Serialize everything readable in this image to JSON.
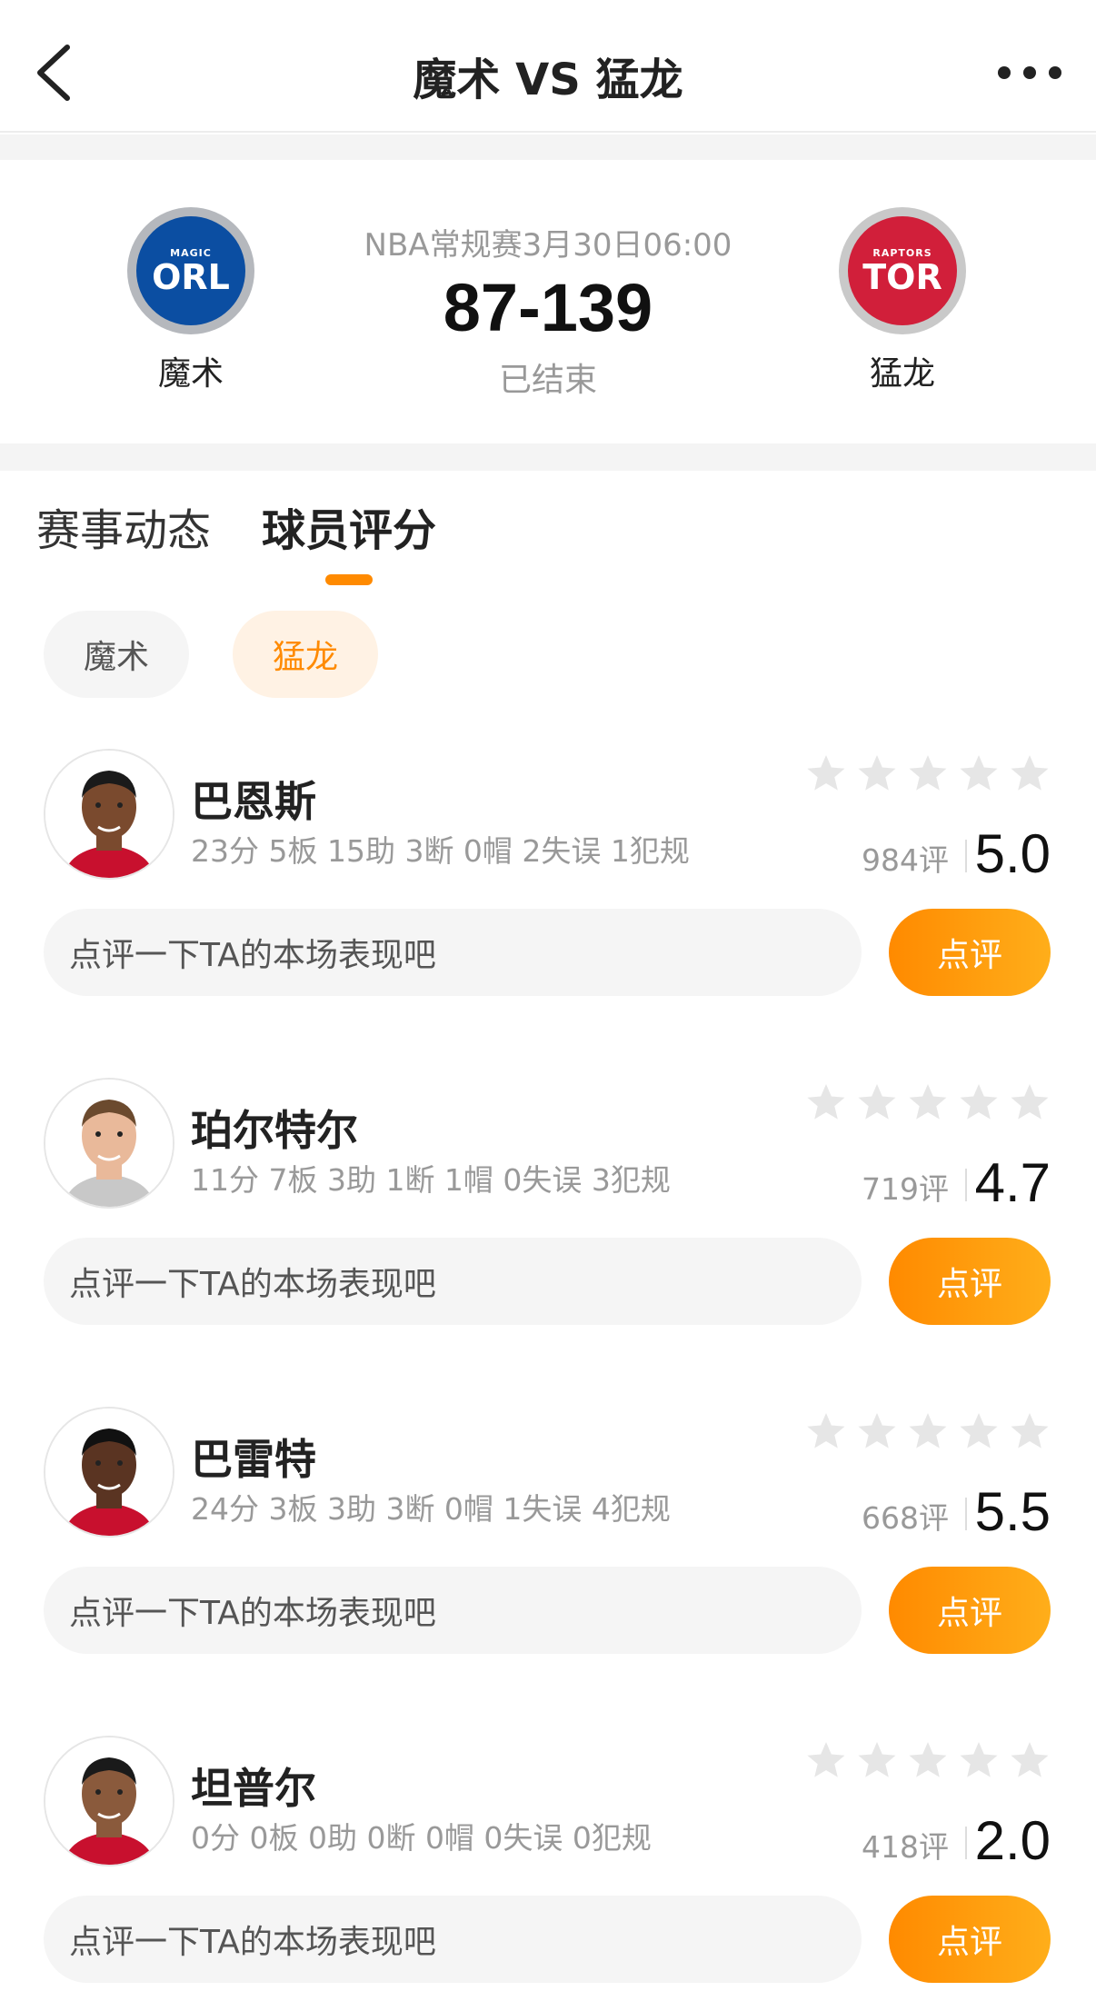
{
  "nav": {
    "title": "魔术 VS 猛龙",
    "back_icon": "chevron-left-icon",
    "more_icon": "more-dots-icon"
  },
  "match": {
    "home": {
      "name": "魔术",
      "logo_small": "MAGIC",
      "logo_big": "ORL",
      "color": "#0b4ea2"
    },
    "away": {
      "name": "猛龙",
      "logo_small": "RAPTORS",
      "logo_big": "TOR",
      "color": "#d11f3a"
    },
    "meta": "NBA常规赛3月30日06:00",
    "score": "87-139",
    "status": "已结束"
  },
  "tabs": [
    {
      "label": "赛事动态",
      "active": false
    },
    {
      "label": "球员评分",
      "active": true
    }
  ],
  "filters": [
    {
      "label": "魔术",
      "active": false
    },
    {
      "label": "猛龙",
      "active": true
    }
  ],
  "colors": {
    "accent": "#ff8a00",
    "star_empty": "#e6e6e6"
  },
  "players": [
    {
      "name": "巴恩斯",
      "stats": "23分 5板 15助 3断 0帽 2失误 1犯规",
      "count": "984评",
      "score": "5.0",
      "stars_filled": 0,
      "comment_placeholder": "点评一下TA的本场表现吧",
      "button": "点评"
    },
    {
      "name": "珀尔特尔",
      "stats": "11分 7板 3助 1断 1帽 0失误 3犯规",
      "count": "719评",
      "score": "4.7",
      "stars_filled": 0,
      "comment_placeholder": "点评一下TA的本场表现吧",
      "button": "点评"
    },
    {
      "name": "巴雷特",
      "stats": "24分 3板 3助 3断 0帽 1失误 4犯规",
      "count": "668评",
      "score": "5.5",
      "stars_filled": 0,
      "comment_placeholder": "点评一下TA的本场表现吧",
      "button": "点评"
    },
    {
      "name": "坦普尔",
      "stats": "0分 0板 0助 0断 0帽 0失误 0犯规",
      "count": "418评",
      "score": "2.0",
      "stars_filled": 0,
      "comment_placeholder": "点评一下TA的本场表现吧",
      "button": "点评"
    }
  ]
}
